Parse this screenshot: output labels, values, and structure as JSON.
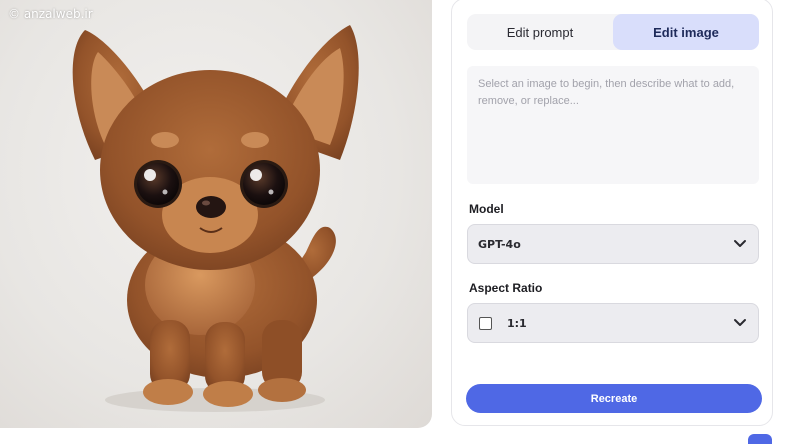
{
  "image_panel": {
    "watermark": "© anzalweb.ir",
    "image_subject": "cartoon-puppy-image"
  },
  "editor": {
    "tabs": [
      {
        "label": "Edit prompt",
        "active": false
      },
      {
        "label": "Edit image",
        "active": true
      }
    ],
    "prompt": {
      "value": "",
      "placeholder": "Select an image to begin, then describe what to add, remove, or replace..."
    },
    "model": {
      "label": "Model",
      "selected": "GPT-4o"
    },
    "aspect_ratio": {
      "label": "Aspect Ratio",
      "selected": "1:1"
    },
    "recreate_label": "Recreate"
  },
  "colors": {
    "accent": "#4f68e5",
    "active_tab": "#d9defb",
    "select_bg": "#ececf0",
    "fur": "#9c5a2e"
  },
  "icons": [
    "chevron-down-icon",
    "square-ratio-icon"
  ]
}
